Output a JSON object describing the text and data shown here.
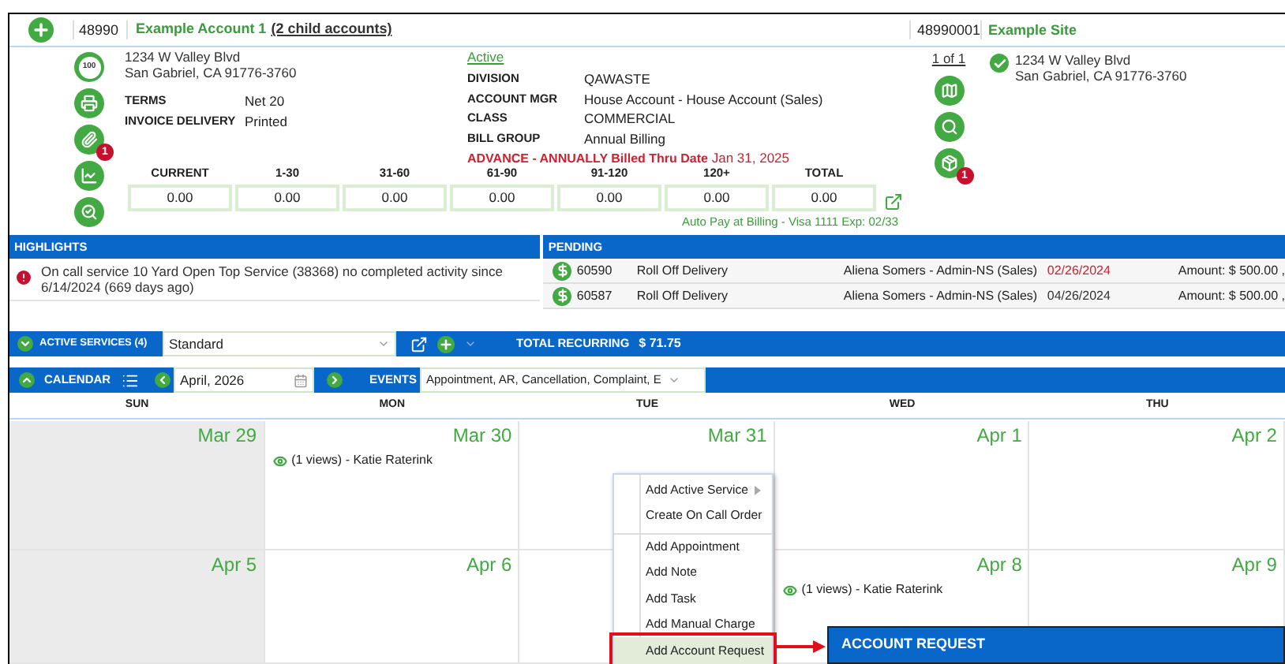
{
  "header": {
    "account_id": "48990",
    "account_name": "Example Account 1",
    "child_accounts": "(2 child accounts)",
    "site_id": "48990001",
    "site_name": "Example Site"
  },
  "left_icons": [
    {
      "kind": "score",
      "text": "100"
    },
    {
      "kind": "register"
    },
    {
      "kind": "attachment",
      "badge": "1"
    },
    {
      "kind": "chart"
    },
    {
      "kind": "lookup"
    }
  ],
  "account": {
    "address_lines": [
      "1234 W Valley Blvd",
      "San Gabriel, CA 91776-3760"
    ],
    "terms": [
      {
        "label": "TERMS",
        "value": "Net 20"
      },
      {
        "label": "INVOICE DELIVERY",
        "value": "Printed"
      }
    ],
    "status": "Active",
    "info": [
      {
        "label": "DIVISION",
        "value": "QAWASTE"
      },
      {
        "label": "ACCOUNT MGR",
        "value": "House Account - House Account (Sales)"
      },
      {
        "label": "CLASS",
        "value": "COMMERCIAL"
      },
      {
        "label": "BILL GROUP",
        "value": "Annual Billing"
      }
    ],
    "billing_note": {
      "label": "ADVANCE - ANNUALLY Billed Thru Date",
      "date": "Jan 31, 2025"
    }
  },
  "aging": {
    "columns": [
      {
        "label": "CURRENT",
        "value": "0.00"
      },
      {
        "label": "1-30",
        "value": "0.00"
      },
      {
        "label": "31-60",
        "value": "0.00"
      },
      {
        "label": "61-90",
        "value": "0.00"
      },
      {
        "label": "91-120",
        "value": "0.00"
      },
      {
        "label": "120+",
        "value": "0.00"
      },
      {
        "label": "TOTAL",
        "value": "0.00"
      }
    ],
    "auto_pay": "Auto Pay at Billing - Visa 1111 Exp: 02/33"
  },
  "site": {
    "pager": "1 of 1",
    "address_lines": [
      "1234 W Valley Blvd",
      "San Gabriel, CA 91776-3760"
    ],
    "icons": [
      {
        "kind": "map"
      },
      {
        "kind": "search"
      },
      {
        "kind": "container",
        "badge": "1"
      }
    ]
  },
  "highlights": {
    "title": "HIGHLIGHTS",
    "items": [
      {
        "text": "On call service 10 Yard Open Top Service (38368) no completed activity since 6/14/2024 (669 days ago)"
      }
    ]
  },
  "pending": {
    "title": "PENDING",
    "rows": [
      {
        "id": "60590",
        "type": "Roll Off Delivery",
        "person": "Aliena Somers - Admin-NS (Sales)",
        "date": "02/26/2024",
        "overdue": true,
        "amount": "Amount: $ 500.00 ,"
      },
      {
        "id": "60587",
        "type": "Roll Off Delivery",
        "person": "Aliena Somers - Admin-NS (Sales)",
        "date": "04/26/2024",
        "overdue": false,
        "amount": "Amount: $ 500.00 ,"
      }
    ]
  },
  "active_services": {
    "label": "ACTIVE SERVICES (4)",
    "select_value": "Standard",
    "total_label": "TOTAL RECURRING",
    "total_value": "$ 71.75"
  },
  "calendar": {
    "label": "CALENDAR",
    "month": "April, 2026",
    "events_label": "EVENTS",
    "events_value": "Appointment, AR, Cancellation, Complaint, E",
    "days": [
      "SUN",
      "MON",
      "TUE",
      "WED",
      "THU"
    ],
    "weeks": [
      [
        {
          "date": "Mar 29",
          "weekend": true
        },
        {
          "date": "Mar 30",
          "weekend": false,
          "events": [
            "(1 views) - Katie Raterink"
          ]
        },
        {
          "date": "Mar 31",
          "weekend": false
        },
        {
          "date": "Apr 1",
          "weekend": false
        },
        {
          "date": "Apr 2",
          "weekend": false
        }
      ],
      [
        {
          "date": "Apr 5",
          "weekend": true
        },
        {
          "date": "Apr 6",
          "weekend": false
        },
        {
          "weekend": false
        },
        {
          "date": "Apr 8",
          "weekend": false,
          "events": [
            "(1 views) - Katie Raterink"
          ]
        },
        {
          "date": "Apr 9",
          "weekend": false
        }
      ]
    ]
  },
  "context_menu": {
    "items": [
      {
        "label": "Add Active Service",
        "submenu": true,
        "separator_before": false,
        "selected": false
      },
      {
        "label": "Create On Call Order",
        "submenu": false,
        "separator_before": false,
        "selected": false
      },
      {
        "label": "Add Appointment",
        "submenu": false,
        "separator_before": true,
        "selected": false
      },
      {
        "label": "Add Note",
        "submenu": false,
        "separator_before": false,
        "selected": false
      },
      {
        "label": "Add Task",
        "submenu": false,
        "separator_before": false,
        "selected": false
      },
      {
        "label": "Add Manual Charge",
        "submenu": false,
        "separator_before": false,
        "selected": false
      },
      {
        "label": "Add Account Request",
        "submenu": false,
        "separator_before": false,
        "selected": true
      }
    ]
  },
  "account_request_panel": {
    "title": "ACCOUNT REQUEST"
  }
}
